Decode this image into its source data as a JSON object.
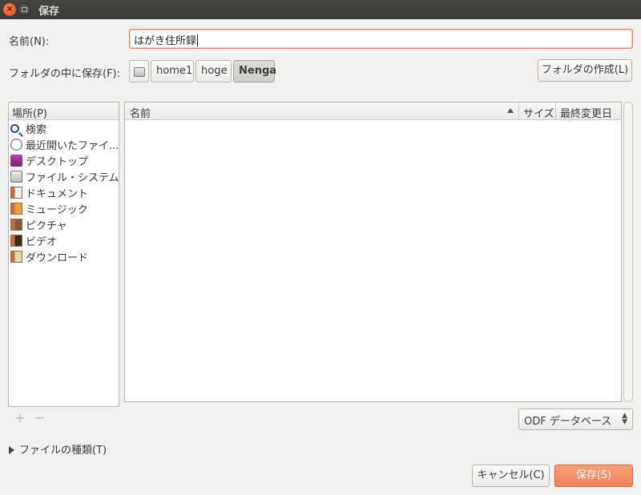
{
  "window": {
    "title": "保存"
  },
  "name_field": {
    "label": "名前(N):",
    "value": "はがき住所録"
  },
  "folder": {
    "label": "フォルダの中に保存(F):",
    "path": [
      "home1",
      "hoge",
      "Nenga"
    ],
    "create_folder_label": "フォルダの作成(L)"
  },
  "places": {
    "header": "場所(P)",
    "items": [
      {
        "label": "検索",
        "icon": "search-icon"
      },
      {
        "label": "最近開いたファイ...",
        "icon": "recent-icon"
      },
      {
        "label": "デスクトップ",
        "icon": "desktop-icon"
      },
      {
        "label": "ファイル・システム",
        "icon": "drive-icon"
      },
      {
        "label": "ドキュメント",
        "icon": "documents-folder-icon"
      },
      {
        "label": "ミュージック",
        "icon": "music-folder-icon"
      },
      {
        "label": "ピクチャ",
        "icon": "pictures-folder-icon"
      },
      {
        "label": "ビデオ",
        "icon": "videos-folder-icon"
      },
      {
        "label": "ダウンロード",
        "icon": "downloads-folder-icon"
      }
    ],
    "add_label": "+",
    "remove_label": "−"
  },
  "files": {
    "columns": {
      "name": "名前",
      "size": "サイズ",
      "modified": "最終変更日"
    },
    "rows": []
  },
  "filetype": {
    "selected": "ODF データベース"
  },
  "expander": {
    "label": "ファイルの種類(T)"
  },
  "actions": {
    "cancel": "キャンセル(C)",
    "save": "保存(S)"
  },
  "colors": {
    "accent": "#ef8058",
    "titlebar": "#3b3a36"
  }
}
